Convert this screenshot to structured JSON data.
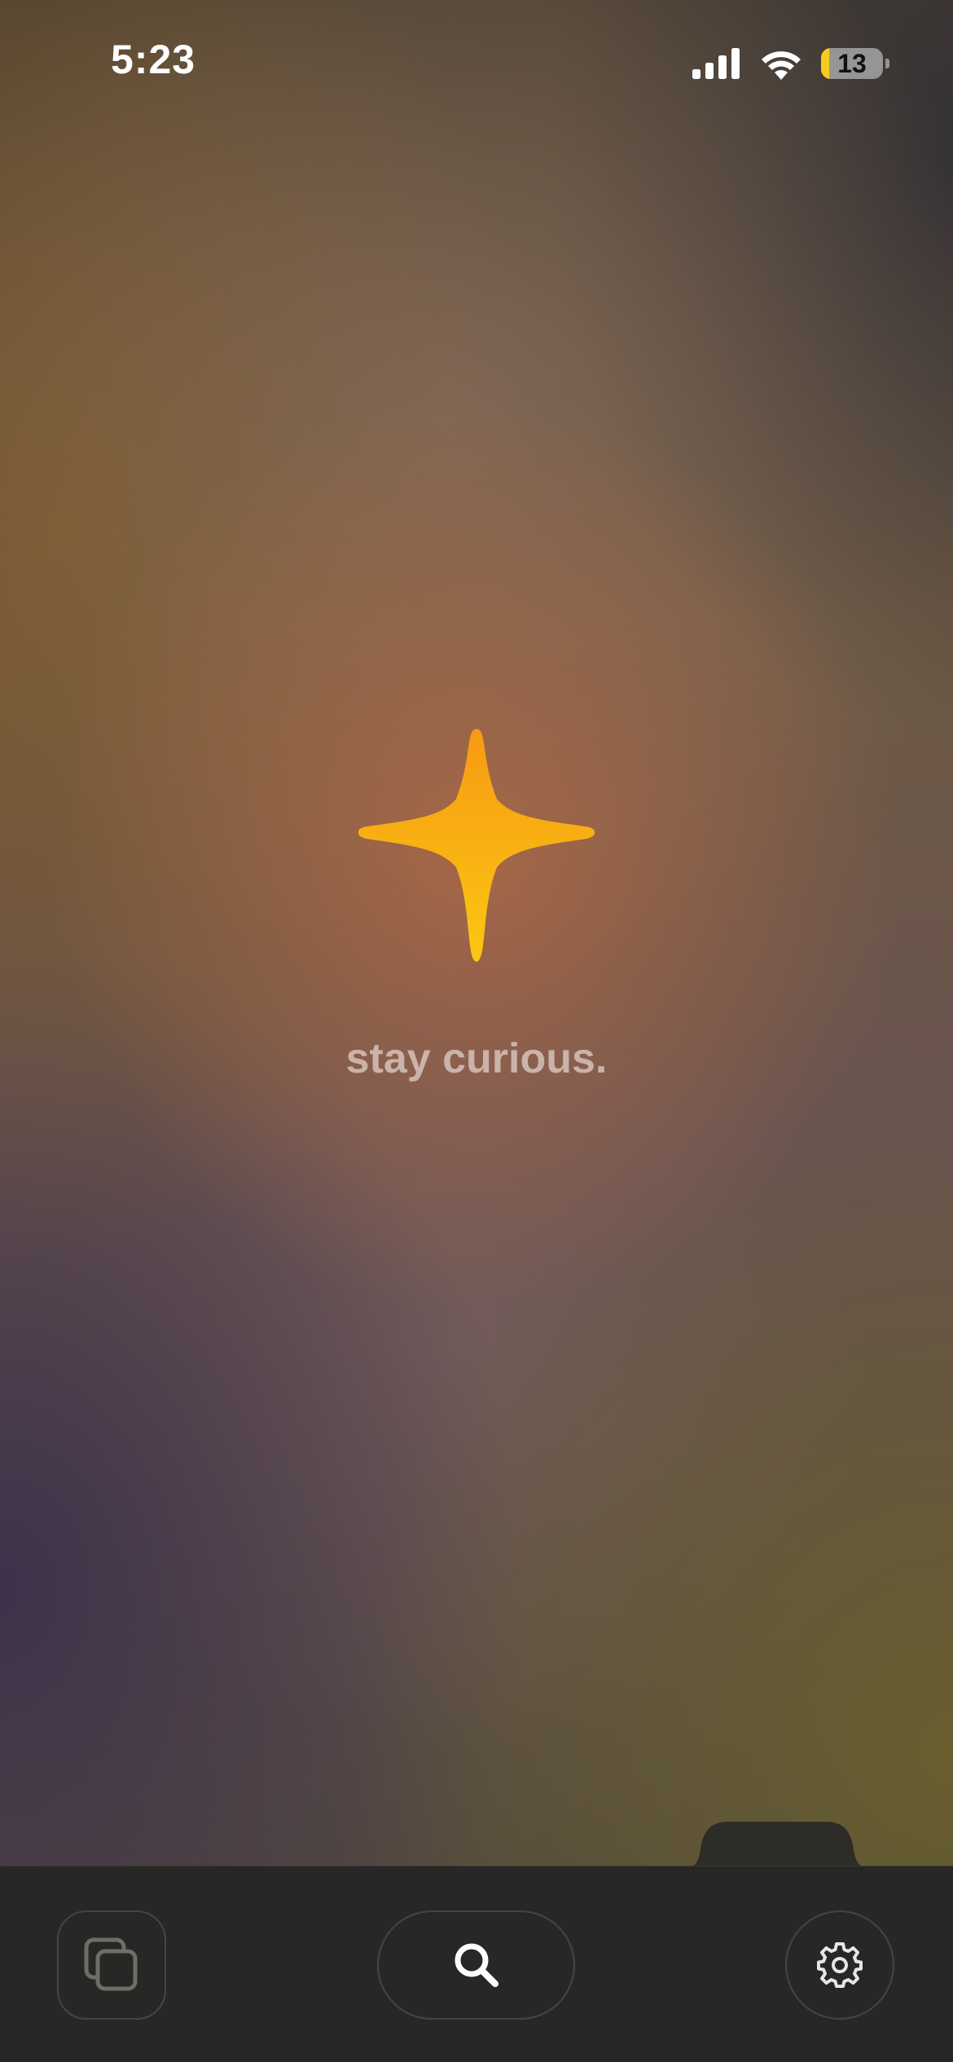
{
  "status_bar": {
    "time": "5:23",
    "battery_level": "13",
    "icons": [
      "signal-icon",
      "wifi-icon",
      "battery-icon"
    ]
  },
  "hero": {
    "icon": "sparkle-icon",
    "icon_color": "#f9b512",
    "tagline": "stay curious."
  },
  "toolbar": {
    "buttons": [
      {
        "name": "tabs-button",
        "icon": "tabs-icon"
      },
      {
        "name": "search-button",
        "icon": "search-icon"
      },
      {
        "name": "settings-button",
        "icon": "gear-icon"
      }
    ]
  },
  "colors": {
    "toolbar_bg": "#282726",
    "accent": "#f9b512"
  }
}
